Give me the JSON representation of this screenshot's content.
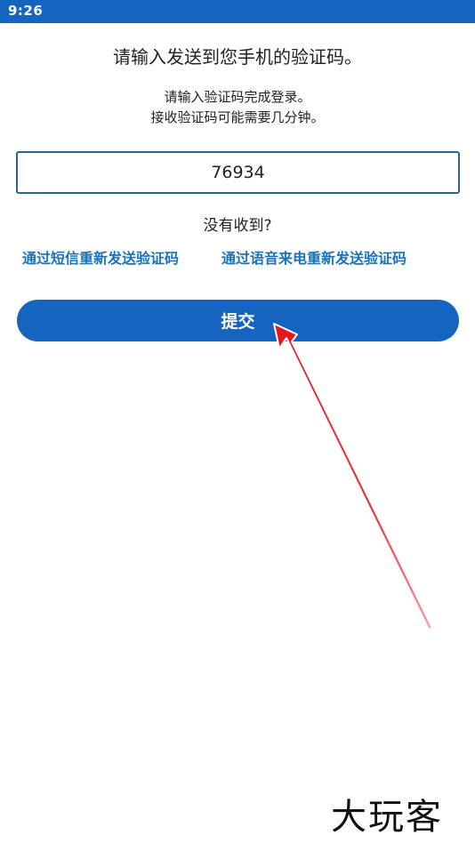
{
  "status_bar": {
    "time": "9:26"
  },
  "page": {
    "heading": "请输入发送到您手机的验证码。",
    "subtitle_line1": "请输入验证码完成登录。",
    "subtitle_line2": "接收验证码可能需要几分钟。",
    "code_input": {
      "value": "76934"
    },
    "not_received": "没有收到?",
    "resend_sms": "通过短信重新发送验证码",
    "resend_voice": "通过语音来电重新发送验证码",
    "submit": "提交"
  },
  "overlay": {
    "arrow_icon": "red-pointer-arrow",
    "color": "#e8141c"
  },
  "watermark": {
    "text": "大玩客"
  },
  "colors": {
    "status_bar": "#1565c0",
    "accent": "#1565c0",
    "link": "#1a73b8",
    "input_border": "#2a6496"
  }
}
